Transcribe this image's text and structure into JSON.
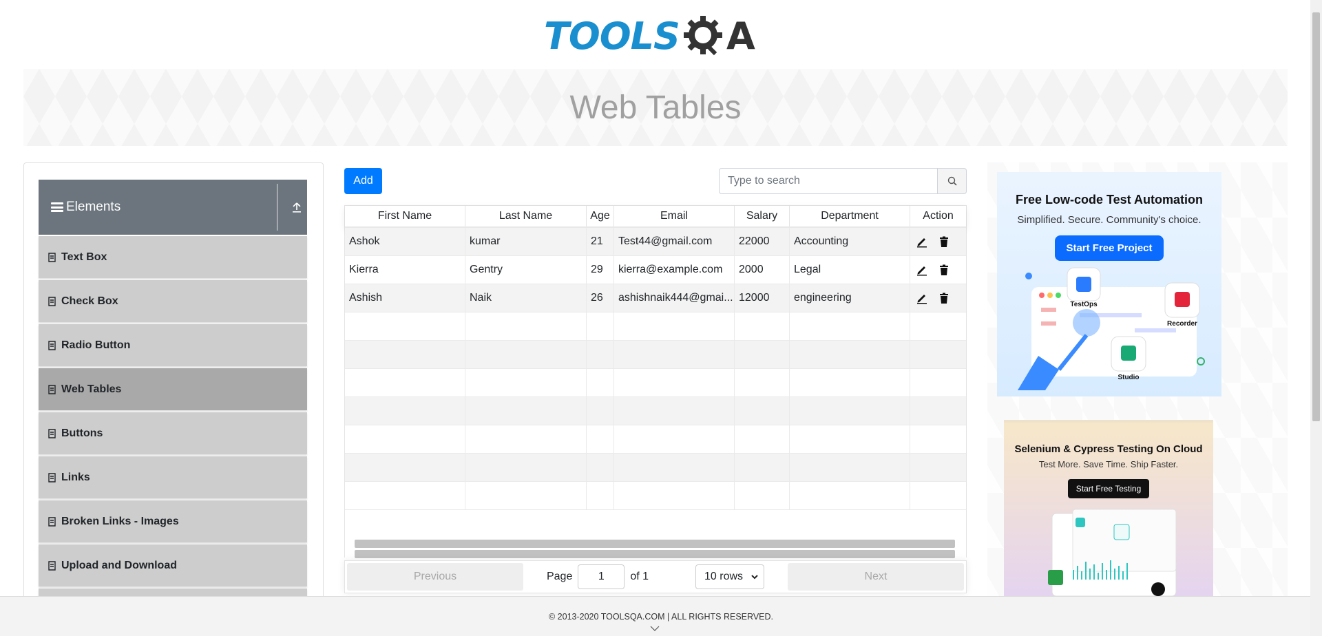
{
  "brand": {
    "logo_text_left": "TOOLS",
    "logo_text_right": "A"
  },
  "banner": {
    "title": "Web Tables"
  },
  "sidebar": {
    "group_title": "Elements",
    "items": [
      {
        "label": "Text Box",
        "active": false
      },
      {
        "label": "Check Box",
        "active": false
      },
      {
        "label": "Radio Button",
        "active": false
      },
      {
        "label": "Web Tables",
        "active": true
      },
      {
        "label": "Buttons",
        "active": false
      },
      {
        "label": "Links",
        "active": false
      },
      {
        "label": "Broken Links - Images",
        "active": false
      },
      {
        "label": "Upload and Download",
        "active": false
      }
    ]
  },
  "toolbar": {
    "add_label": "Add",
    "search_placeholder": "Type to search"
  },
  "table": {
    "columns": [
      "First Name",
      "Last Name",
      "Age",
      "Email",
      "Salary",
      "Department",
      "Action"
    ],
    "rows": [
      {
        "first": "Ashok",
        "last": "kumar",
        "age": "21",
        "email": "Test44@gmail.com",
        "salary": "22000",
        "dept": "Accounting"
      },
      {
        "first": "Kierra",
        "last": "Gentry",
        "age": "29",
        "email": "kierra@example.com",
        "salary": "2000",
        "dept": "Legal"
      },
      {
        "first": "Ashish",
        "last": "Naik",
        "age": "26",
        "email": "ashishnaik444@gmai...",
        "salary": "12000",
        "dept": "engineering"
      }
    ]
  },
  "pagination": {
    "previous_label": "Previous",
    "next_label": "Next",
    "page_label": "Page",
    "current_page": "1",
    "of_label": "of 1",
    "rows_option": "10 rows"
  },
  "ads": {
    "ad1_title": "Free Low-code Test Automation",
    "ad1_subtitle": "Simplified. Secure. Community's choice.",
    "ad1_cta": "Start Free Project",
    "ad1_label_testops": "TestOps",
    "ad1_label_recorder": "Recorder",
    "ad1_label_studio": "Studio",
    "ad2_title": "Selenium & Cypress Testing On Cloud",
    "ad2_subtitle": "Test More. Save Time. Ship Faster.",
    "ad2_cta": "Start Free Testing"
  },
  "footer": {
    "copyright": "© 2013-2020 TOOLSQA.COM | ALL RIGHTS RESERVED."
  },
  "colors": {
    "primary": "#007bff",
    "sidebar_header": "#6c757d",
    "menu_item": "#cdcdcd",
    "menu_active": "#a9a9a9",
    "logo_blue": "#1a8fd0"
  }
}
